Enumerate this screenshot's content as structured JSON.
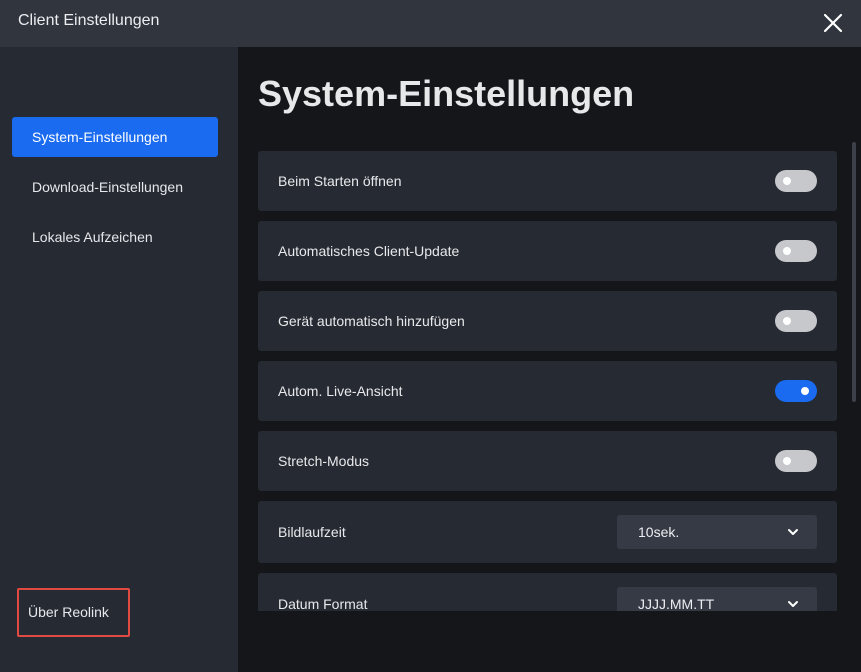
{
  "window": {
    "title": "Client Einstellungen"
  },
  "sidebar": {
    "items": [
      {
        "label": "System-Einstellungen",
        "active": true
      },
      {
        "label": "Download-Einstellungen",
        "active": false
      },
      {
        "label": "Lokales Aufzeichen",
        "active": false
      }
    ],
    "about_label": "Über Reolink"
  },
  "main": {
    "title": "System-Einstellungen",
    "settings": [
      {
        "label": "Beim Starten öffnen",
        "type": "toggle",
        "on": false
      },
      {
        "label": "Automatisches Client-Update",
        "type": "toggle",
        "on": false
      },
      {
        "label": "Gerät automatisch hinzufügen",
        "type": "toggle",
        "on": false
      },
      {
        "label": "Autom. Live-Ansicht",
        "type": "toggle",
        "on": true
      },
      {
        "label": "Stretch-Modus",
        "type": "toggle",
        "on": false
      },
      {
        "label": "Bildlaufzeit",
        "type": "select",
        "value": "10sek."
      },
      {
        "label": "Datum Format",
        "type": "select",
        "value": "JJJJ.MM.TT"
      }
    ]
  },
  "colors": {
    "accent": "#1a6bf0",
    "highlight_border": "#e04a43",
    "toggle_off": "#c7c8cb"
  },
  "icons": {
    "close": "close-icon",
    "dropdown": "chevron-down-icon"
  }
}
